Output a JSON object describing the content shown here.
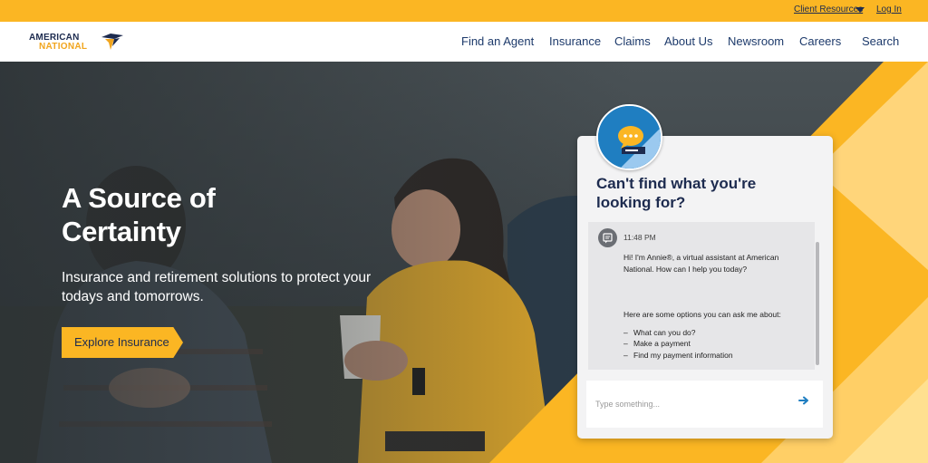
{
  "topbar": {
    "client_resources": "Client Resources",
    "login": "Log In"
  },
  "header": {
    "logo_line1": "AMERICAN",
    "logo_line2": "NATIONAL",
    "nav": [
      "Find an Agent",
      "Insurance",
      "Claims",
      "About Us",
      "Newsroom",
      "Careers"
    ],
    "search": "Search"
  },
  "hero": {
    "title": "A Source of Certainty",
    "subtitle": "Insurance and retirement solutions to protect your todays and tomorrows.",
    "cta": "Explore Insurance"
  },
  "chat": {
    "heading": "Can't find what you're looking for?",
    "time": "11:48 PM",
    "greeting": "Hi! I'm Annie®, a virtual assistant at American National. How can I help you today?",
    "options_intro": "Here are some options you can ask me about:",
    "options": [
      "What can you do?",
      "Make a payment",
      "Find my payment information"
    ],
    "input_placeholder": "Type something..."
  },
  "colors": {
    "brand_yellow": "#fbb623",
    "brand_navy": "#1d2b4f",
    "nav_text": "#1d3a6b"
  },
  "icons": [
    "caret-down-icon",
    "logo-eagle-icon",
    "chat-bubble-icon",
    "message-icon",
    "send-arrow-icon"
  ]
}
